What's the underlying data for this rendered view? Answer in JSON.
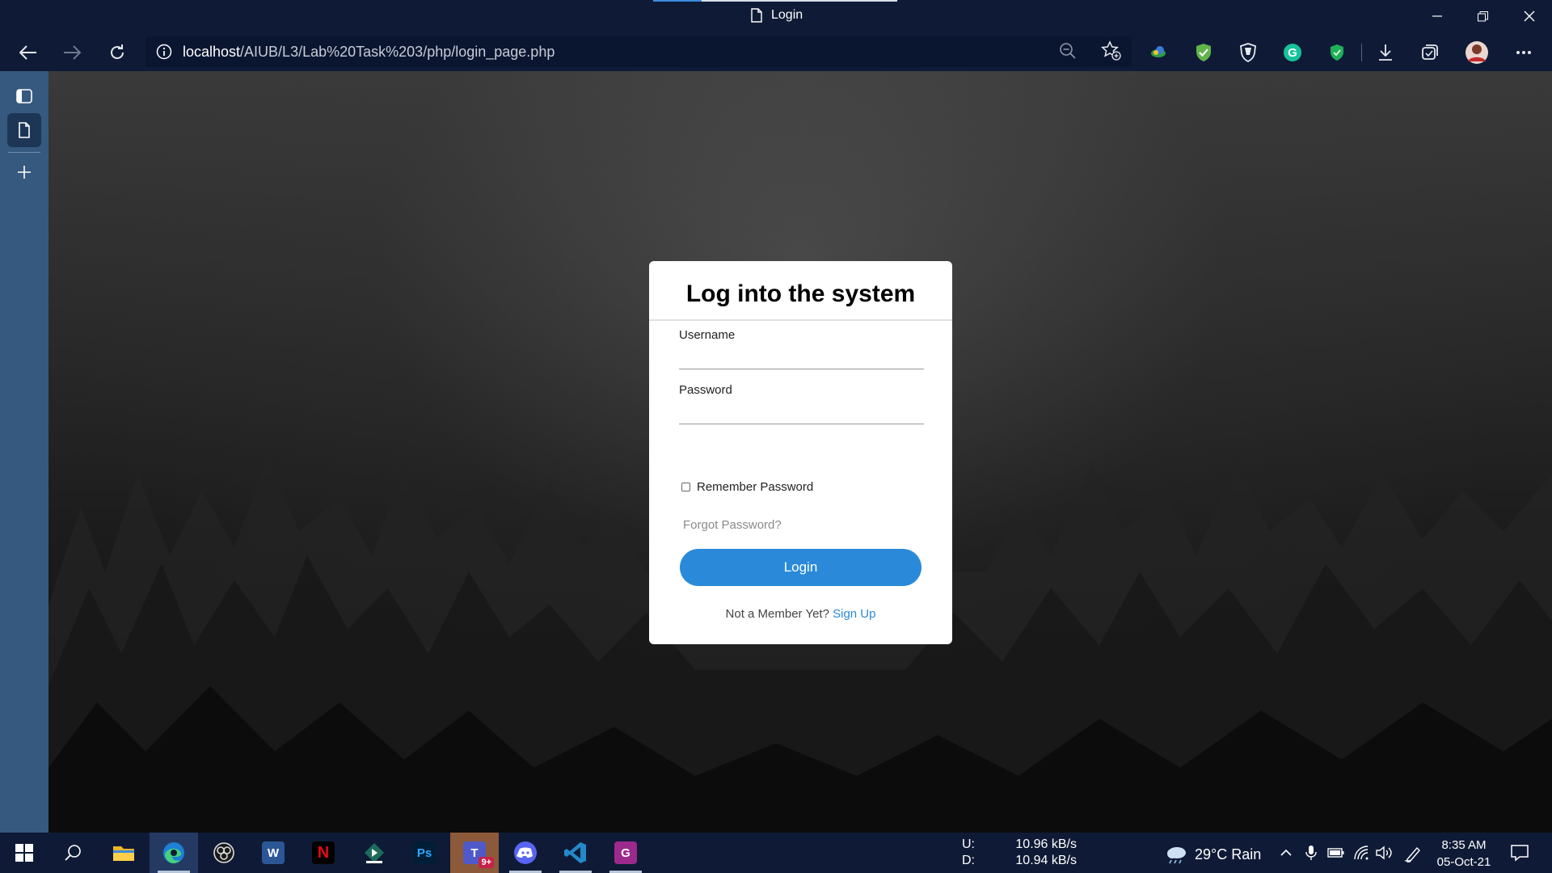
{
  "window": {
    "tab_title": "Login"
  },
  "toolbar": {
    "url_host": "localhost",
    "url_path": "/AIUB/L3/Lab%20Task%203/php/login_page.php",
    "extensions": [
      "copilot-icon",
      "adguard-icon",
      "brave-shield-icon",
      "grammarly-icon",
      "vpn-shield-icon"
    ]
  },
  "login": {
    "heading": "Log into the system",
    "username_label": "Username",
    "username_value": "",
    "password_label": "Password",
    "password_value": "",
    "remember_label": "Remember Password",
    "remember_checked": false,
    "forgot_label": "Forgot Password?",
    "login_button": "Login",
    "member_text": "Not a Member Yet?",
    "signup_link": "Sign Up"
  },
  "taskbar": {
    "apps": [
      "start",
      "search",
      "file-explorer",
      "edge",
      "obs",
      "word",
      "netflix",
      "stremio",
      "photoshop",
      "teams",
      "discord",
      "vscode",
      "pdf-reader"
    ],
    "teams_badge": "9+",
    "net_up_label": "U:",
    "net_up_value": "10.96 kB/s",
    "net_down_label": "D:",
    "net_down_value": "10.94 kB/s",
    "weather": "29°C Rain",
    "time": "8:35 AM",
    "date": "05-Oct-21"
  },
  "colors": {
    "accent": "#2a8ad9",
    "chrome": "#0f1b36",
    "sidebar": "#36597f"
  }
}
